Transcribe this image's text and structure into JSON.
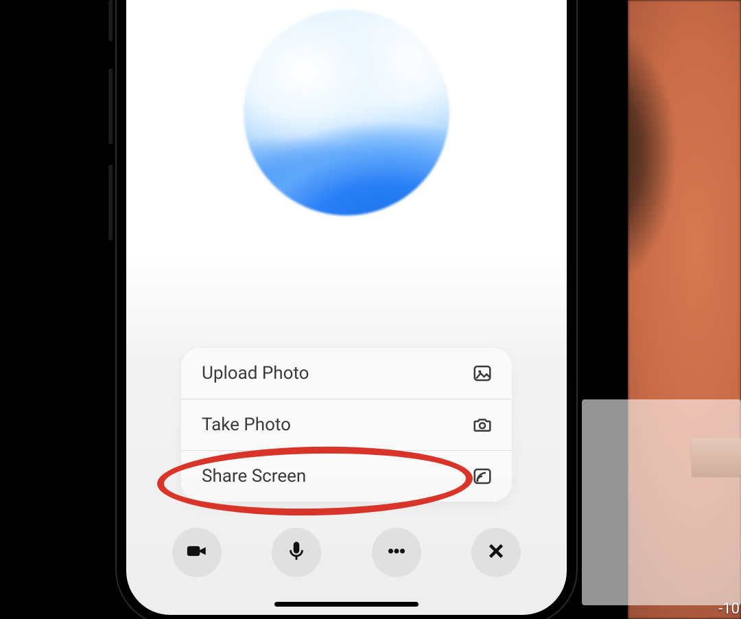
{
  "menu": {
    "items": [
      {
        "label": "Upload Photo",
        "icon": "image-icon"
      },
      {
        "label": "Take Photo",
        "icon": "camera-icon"
      },
      {
        "label": "Share Screen",
        "icon": "cast-icon"
      }
    ]
  },
  "controls": {
    "video": {
      "icon": "video-icon"
    },
    "mic": {
      "icon": "microphone-icon"
    },
    "more": {
      "icon": "more-icon"
    },
    "close": {
      "icon": "close-icon"
    }
  },
  "annotation": {
    "highlight_target": "share-screen-item",
    "color": "#d9342a"
  },
  "video_overlay": {
    "timestamp_text": "-10"
  }
}
